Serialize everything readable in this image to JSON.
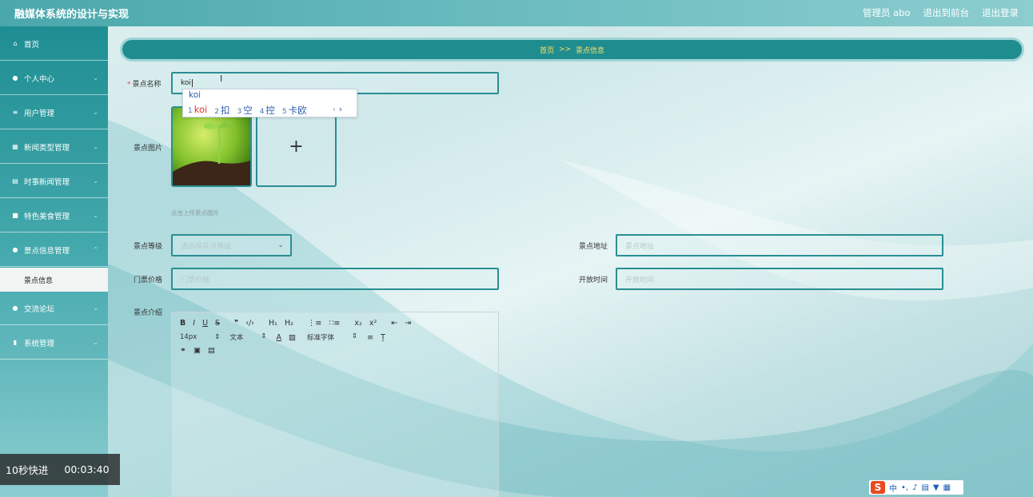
{
  "header": {
    "app_title": "融媒体系统的设计与实现",
    "user": "管理员 abo",
    "to_front": "退出到前台",
    "logout": "退出登录"
  },
  "sidebar": {
    "items": [
      {
        "label": "首页",
        "icon": "home-icon"
      },
      {
        "label": "个人中心",
        "icon": "user-icon"
      },
      {
        "label": "用户管理",
        "icon": "sliders-icon"
      },
      {
        "label": "新闻类型管理",
        "icon": "grid-icon"
      },
      {
        "label": "时事新闻管理",
        "icon": "table-icon"
      },
      {
        "label": "特色美食管理",
        "icon": "briefcase-icon"
      },
      {
        "label": "景点信息管理",
        "icon": "user-icon"
      },
      {
        "label": "交流论坛",
        "icon": "pin-icon"
      },
      {
        "label": "系统管理",
        "icon": "clipboard-icon"
      }
    ],
    "active_sub": "景点信息"
  },
  "video_overlay": {
    "speed": "10秒快进",
    "time": "00:03:40"
  },
  "breadcrumb": {
    "home": "首页",
    "sep": ">>",
    "current": "景点信息"
  },
  "form": {
    "name_label": "景点名称",
    "name_value": "koi",
    "image_label": "景点图片",
    "image_hint": "点击上传景点图片",
    "grade_label": "景点等级",
    "grade_placeholder": "请选择景点等级",
    "address_label": "景点地址",
    "address_placeholder": "景点地址",
    "price_label": "门票价格",
    "price_placeholder": "门票价格",
    "open_label": "开放时间",
    "open_placeholder": "开放时间",
    "intro_label": "景点介绍"
  },
  "ime": {
    "input": "koi",
    "candidates": [
      {
        "n": "1",
        "text": "koi"
      },
      {
        "n": "2",
        "text": "扣"
      },
      {
        "n": "3",
        "text": "空"
      },
      {
        "n": "4",
        "text": "控"
      },
      {
        "n": "5",
        "text": "卡欧"
      }
    ]
  },
  "editor": {
    "font_size": "14px",
    "text_type": "文本",
    "font_family": "标准字体"
  },
  "taskbar_ime": {
    "lang": "中"
  }
}
